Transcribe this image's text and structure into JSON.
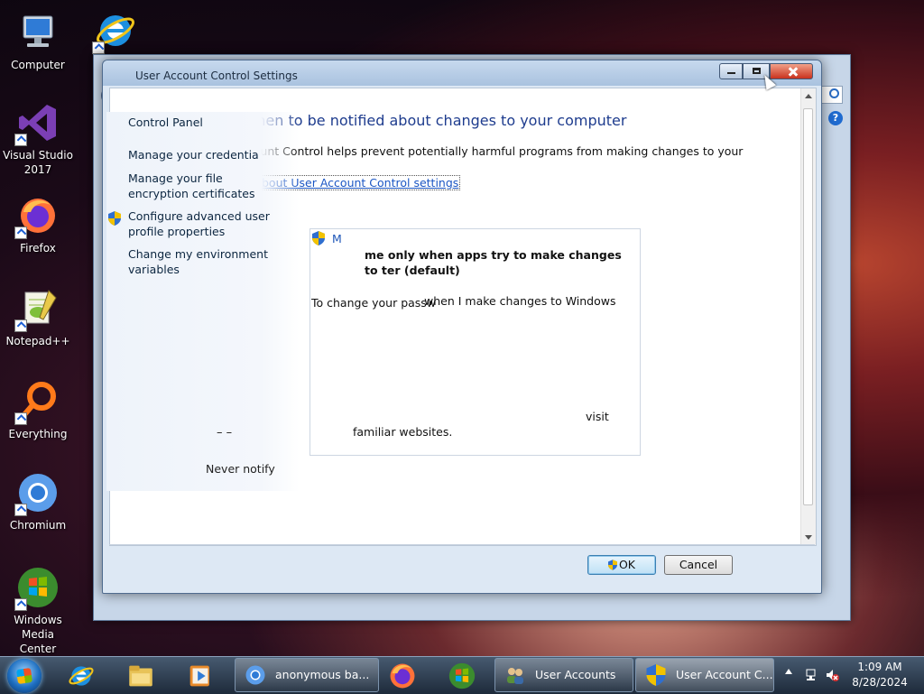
{
  "desktop": {
    "icons": [
      {
        "label": "Computer"
      },
      {
        "label": "Visual Studio 2017"
      },
      {
        "label": "Firefox"
      },
      {
        "label": "Notepad++"
      },
      {
        "label": "Everything"
      },
      {
        "label": "Chromium"
      },
      {
        "label": "Windows Media Center"
      }
    ]
  },
  "control_panel": {
    "sidebar": [
      {
        "label": "Control Panel"
      },
      {
        "label": "Manage your credentia"
      },
      {
        "label": "Manage your file encryption certificates"
      },
      {
        "label": "Configure advanced user profile properties"
      },
      {
        "label": "Change my environment variables"
      }
    ]
  },
  "uac_dialog": {
    "title": "User Account Control Settings",
    "heading": "Choose when to be notified about changes to your computer",
    "description": "ccount Control helps prevent potentially harmful programs from making changes to your",
    "link": "bout User Account Control settings",
    "shield_label": "M",
    "setting_title": "me only when apps try to make changes to ter (default)",
    "setting_line": "when I make changes to Windows",
    "password_text": "To change your passw",
    "visit_text": "visit",
    "familiar_text": "familiar websites.",
    "slider_marks": "–    –",
    "never_notify": "Never notify",
    "ok_label": "OK",
    "cancel_label": "Cancel"
  },
  "taskbar": {
    "tasks": [
      {
        "label": "anonymous ba..."
      },
      {
        "label": "User Accounts"
      },
      {
        "label": "User Account C..."
      }
    ],
    "clock_time": "1:09 AM",
    "clock_date": "8/28/2024"
  },
  "colors": {
    "heading": "#1e3c8e",
    "link": "#1b56c4",
    "taskbar": "#2b3a4c"
  }
}
